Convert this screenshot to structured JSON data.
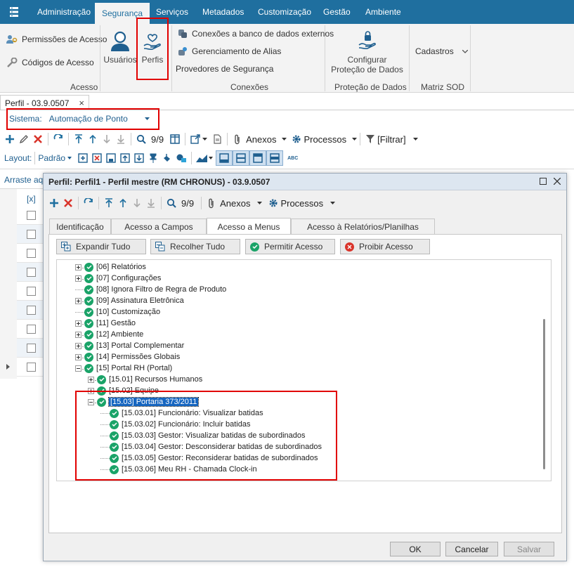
{
  "ribbon": {
    "tabs": [
      "Administração",
      "Segurança",
      "Serviços",
      "Metadados",
      "Customização",
      "Gestão",
      "Ambiente"
    ],
    "acesso": {
      "permissoes": "Permissões de Acesso",
      "codigos": "Códigos de Acesso",
      "usuarios": "Usuários",
      "perfis": "Perfis",
      "group": "Acesso"
    },
    "conexoes": {
      "banco": "Conexões a banco de dados externos",
      "alias": "Gerenciamento de Alias",
      "provedores": "Provedores de Segurança",
      "group": "Conexões"
    },
    "protecao": {
      "configurar_l1": "Configurar",
      "configurar_l2": "Proteção de Dados",
      "group": "Proteção de Dados"
    },
    "matriz": {
      "cadastros": "Cadastros",
      "group": "Matriz SOD"
    }
  },
  "doc_tab": {
    "label": "Perfil - 03.9.0507",
    "close": "×"
  },
  "sistema": {
    "label": "Sistema:",
    "value": "Automação de Ponto"
  },
  "toolbar": {
    "page": "9/9",
    "anexos": "Anexos",
    "processos": "Processos",
    "filtrar": "[Filtrar]"
  },
  "layout_bar": {
    "label": "Layout:",
    "value": "Padrão",
    "abc": "ABC"
  },
  "grid": {
    "drag_hint": "Arraste aqu",
    "col_header": "[x]",
    "rows": 9
  },
  "dialog": {
    "title": "Perfil: Perfil1 - Perfil mestre (RM CHRONUS) - 03.9.0507",
    "toolbar": {
      "page": "9/9",
      "anexos": "Anexos",
      "processos": "Processos"
    },
    "tabs": [
      "Identificação",
      "Acesso a Campos",
      "Acesso a Menus",
      "Acesso à Relatórios/Planilhas"
    ],
    "active_tab": "Acesso a Menus",
    "actions": [
      "Expandir Tudo",
      "Recolher Tudo",
      "Permitir Acesso",
      "Proibir Acesso"
    ],
    "tree": [
      {
        "label": "[06] Relatórios",
        "expander": "plus"
      },
      {
        "label": "[07] Configurações",
        "expander": "plus"
      },
      {
        "label": "[08] Ignora Filtro de Regra de Produto",
        "expander": "none"
      },
      {
        "label": "[09] Assinatura Eletrônica",
        "expander": "plus"
      },
      {
        "label": "[10] Customização",
        "expander": "none"
      },
      {
        "label": "[11] Gestão",
        "expander": "plus"
      },
      {
        "label": "[12] Ambiente",
        "expander": "plus"
      },
      {
        "label": "[13] Portal Complementar",
        "expander": "plus"
      },
      {
        "label": "[14] Permissões Globais",
        "expander": "plus"
      },
      {
        "label": "[15] Portal RH (Portal)",
        "expander": "minus"
      },
      {
        "label": "[15.01] Recursos Humanos",
        "expander": "plus"
      },
      {
        "label": "[15.02] Equipe",
        "expander": "plus"
      },
      {
        "label": "[15.03] Portaria 373/2011",
        "expander": "minus"
      },
      {
        "label": "[15.03.01] Funcionário: Visualizar batidas",
        "expander": "none"
      },
      {
        "label": "[15.03.02] Funcionário: Incluir batidas",
        "expander": "none"
      },
      {
        "label": "[15.03.03] Gestor: Visualizar batidas de subordinados",
        "expander": "none"
      },
      {
        "label": "[15.03.04] Gestor: Desconsiderar batidas de subordinados",
        "expander": "none"
      },
      {
        "label": "[15.03.05] Gestor: Reconsiderar batidas de subordinados",
        "expander": "none"
      },
      {
        "label": "[15.03.06] Meu RH - Chamada Clock-in",
        "expander": "none"
      }
    ],
    "footer": {
      "ok": "OK",
      "cancel": "Cancelar",
      "save": "Salvar"
    }
  },
  "colors": {
    "ribbon_blue": "#1f6f9f",
    "highlight_red": "#e10000",
    "ok_green": "#1aa368",
    "deny_red": "#d9342b",
    "selection_blue": "#1565c0"
  }
}
